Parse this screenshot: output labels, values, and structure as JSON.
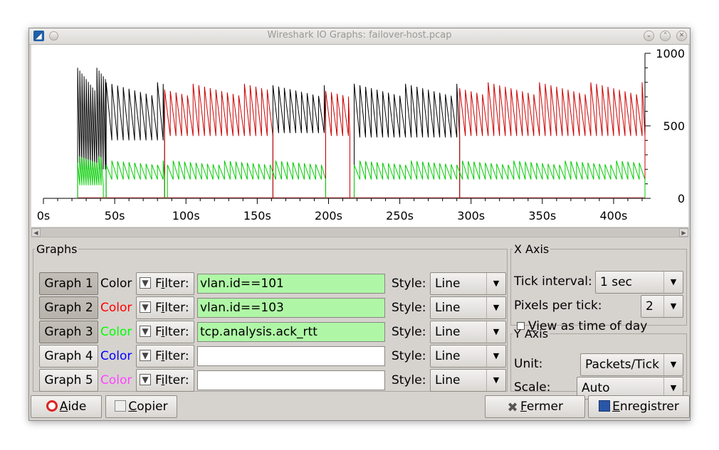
{
  "window": {
    "title": "Wireshark IO Graphs: failover-host.pcap",
    "buttons": [
      "minimize",
      "maximize",
      "close"
    ]
  },
  "chart_data": {
    "type": "line",
    "title": "",
    "xlabel": "",
    "ylabel": "",
    "x_ticks": [
      "0s",
      "50s",
      "100s",
      "150s",
      "200s",
      "250s",
      "300s",
      "350s",
      "400s"
    ],
    "y_ticks": [
      "0",
      "500",
      "1000"
    ],
    "xlim": [
      0,
      422
    ],
    "ylim": [
      0,
      1000
    ],
    "grid": false,
    "series": [
      {
        "color": "#000000",
        "segments": [
          {
            "start": 24,
            "end": 44,
            "low": 200,
            "high": 900,
            "period": 1.5
          },
          {
            "start": 44,
            "end": 85,
            "low": 400,
            "high": 800,
            "period": 4
          },
          {
            "start": 161,
            "end": 198,
            "low": 450,
            "high": 780,
            "period": 4
          },
          {
            "start": 218,
            "end": 292,
            "low": 420,
            "high": 790,
            "period": 4
          }
        ]
      },
      {
        "color": "#cc0000",
        "segments": [
          {
            "start": 85,
            "end": 161,
            "low": 430,
            "high": 790,
            "period": 4
          },
          {
            "start": 198,
            "end": 215,
            "low": 430,
            "high": 780,
            "period": 4
          },
          {
            "start": 292,
            "end": 422,
            "low": 430,
            "high": 800,
            "period": 4
          }
        ]
      },
      {
        "color": "#00cc00",
        "segments": [
          {
            "start": 24,
            "end": 42,
            "low": 90,
            "high": 290,
            "period": 1.5
          },
          {
            "start": 44,
            "end": 85,
            "low": 130,
            "high": 260,
            "period": 4
          },
          {
            "start": 87,
            "end": 198,
            "low": 130,
            "high": 260,
            "period": 4
          },
          {
            "start": 218,
            "end": 422,
            "low": 130,
            "high": 260,
            "period": 4
          }
        ]
      }
    ]
  },
  "graphs_panel": {
    "title": "Graphs",
    "color_label": "Color",
    "filter_label": "Filter:",
    "filter_mnemonic": "i",
    "style_label": "Style:",
    "rows": [
      {
        "button": "Graph 1",
        "pressed": true,
        "color": "#000000",
        "filter": "vlan.id==101",
        "valid": true,
        "style": "Line"
      },
      {
        "button": "Graph 2",
        "pressed": true,
        "color": "#ff0000",
        "filter": "vlan.id==103",
        "valid": true,
        "style": "Line"
      },
      {
        "button": "Graph 3",
        "pressed": true,
        "color": "#00ff00",
        "filter": "tcp.analysis.ack_rtt",
        "valid": true,
        "style": "Line"
      },
      {
        "button": "Graph 4",
        "pressed": false,
        "color": "#0000ff",
        "filter": "",
        "valid": false,
        "style": "Line"
      },
      {
        "button": "Graph 5",
        "pressed": false,
        "color": "#ff44ff",
        "filter": "",
        "valid": false,
        "style": "Line"
      }
    ]
  },
  "x_axis": {
    "title": "X Axis",
    "tick_interval_label": "Tick interval:",
    "tick_interval_value": "1 sec",
    "pixels_per_tick_label": "Pixels per tick:",
    "pixels_per_tick_value": "2",
    "time_of_day_label": "View as time of day",
    "time_of_day_checked": false
  },
  "y_axis": {
    "title": "Y Axis",
    "unit_label": "Unit:",
    "unit_value": "Packets/Tick",
    "scale_label": "Scale:",
    "scale_value": "Auto"
  },
  "buttons": {
    "help": "Aide",
    "copy": "Copier",
    "close": "Fermer",
    "save": "Enregistrer"
  }
}
